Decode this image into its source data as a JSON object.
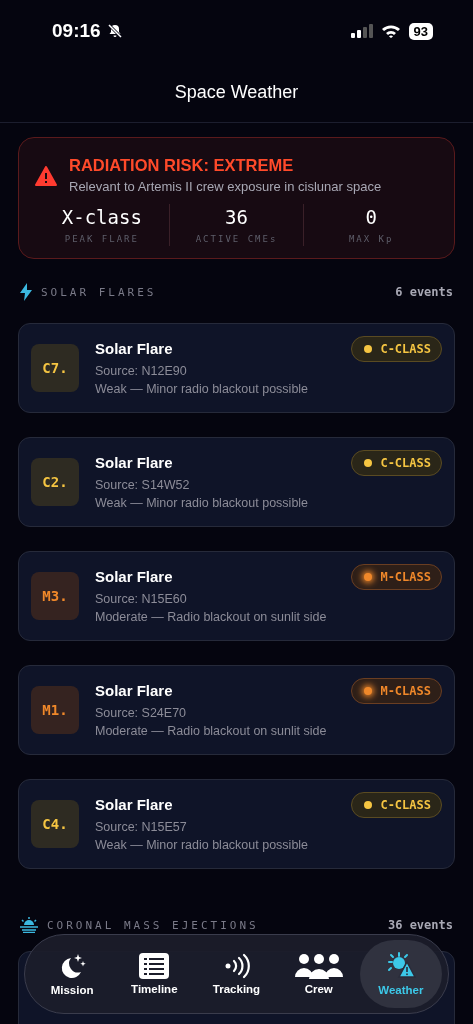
{
  "status_bar": {
    "time": "09:16",
    "battery": "93"
  },
  "title": "Space Weather",
  "alert": {
    "title": "RADIATION RISK: EXTREME",
    "subtitle": "Relevant to Artemis II crew exposure in cislunar space",
    "stats": [
      {
        "value": "X-class",
        "label": "PEAK FLARE"
      },
      {
        "value": "36",
        "label": "ACTIVE CMEs"
      },
      {
        "value": "0",
        "label": "MAX Kp"
      }
    ]
  },
  "sections": [
    {
      "kind": "flares",
      "title": "SOLAR FLARES",
      "count": "6 events"
    },
    {
      "kind": "cme",
      "title": "CORONAL MASS EJECTIONS",
      "count": "36 events"
    }
  ],
  "flares": [
    {
      "kind": "c",
      "code": "C7.",
      "title": "Solar Flare",
      "source": "Source: N12E90",
      "impact": "Weak — Minor radio blackout possible",
      "badge": "C-CLASS"
    },
    {
      "kind": "c",
      "code": "C2.",
      "title": "Solar Flare",
      "source": "Source: S14W52",
      "impact": "Weak — Minor radio blackout possible",
      "badge": "C-CLASS"
    },
    {
      "kind": "m",
      "code": "M3.",
      "title": "Solar Flare",
      "source": "Source: N15E60",
      "impact": "Moderate — Radio blackout on sunlit side",
      "badge": "M-CLASS"
    },
    {
      "kind": "m",
      "code": "M1.",
      "title": "Solar Flare",
      "source": "Source: S24E70",
      "impact": "Moderate — Radio blackout on sunlit side",
      "badge": "M-CLASS"
    },
    {
      "kind": "c",
      "code": "C4.",
      "title": "Solar Flare",
      "source": "Source: N15E57",
      "impact": "Weak — Minor radio blackout possible",
      "badge": "C-CLASS"
    }
  ],
  "tabs": [
    {
      "kind": "mission",
      "label": "Mission",
      "selected": false
    },
    {
      "kind": "timeline",
      "label": "Timeline",
      "selected": false
    },
    {
      "kind": "tracking",
      "label": "Tracking",
      "selected": false
    },
    {
      "kind": "crew",
      "label": "Crew",
      "selected": false
    },
    {
      "kind": "weather",
      "label": "Weather",
      "selected": true
    }
  ]
}
